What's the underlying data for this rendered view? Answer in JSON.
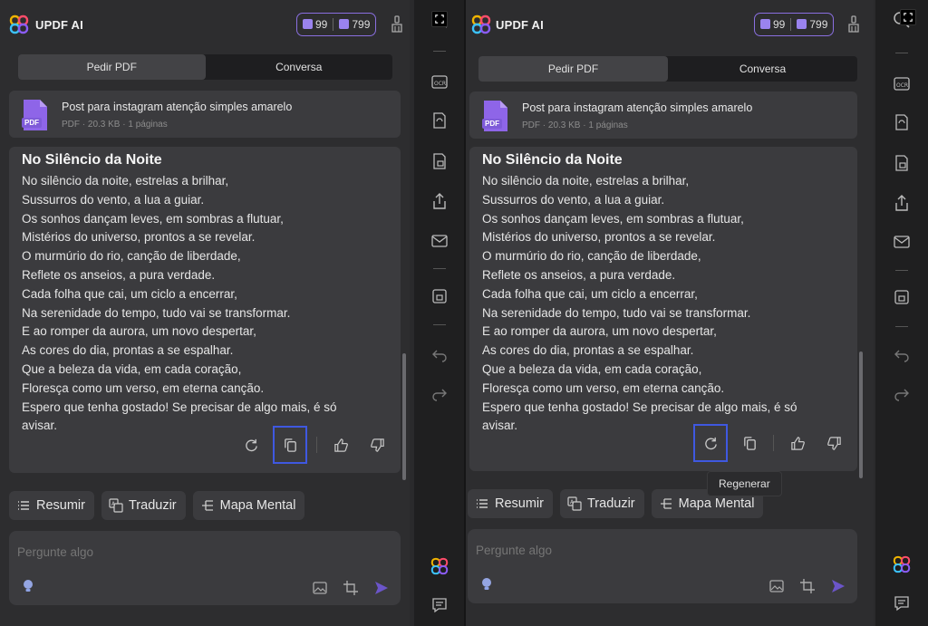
{
  "app": {
    "brand": "UPDF AI",
    "credit_pdf": "99",
    "credit_chat": "799"
  },
  "tabs": [
    "Pedir PDF",
    "Conversa"
  ],
  "file": {
    "name": "Post para instagram atenção simples amarelo",
    "meta": "PDF · 20.3 KB · 1 páginas",
    "badge": "PDF"
  },
  "answer": {
    "title": "No Silêncio da Noite",
    "lines": [
      "No silêncio da noite, estrelas a brilhar,",
      "Sussurros do vento, a lua a guiar.",
      "Os sonhos dançam leves, em sombras a flutuar,",
      "Mistérios do universo, prontos a se revelar.",
      "O murmúrio do rio, canção de liberdade,",
      "Reflete os anseios, a pura verdade.",
      "Cada folha que cai, um ciclo a encerrar,",
      "Na serenidade do tempo, tudo vai se transformar.",
      "E ao romper da aurora, um novo despertar,",
      "As cores do dia, prontas a se espalhar.",
      "Que a beleza da vida, em cada coração,",
      "Floresça como um verso, em eterna canção.",
      "Espero que tenha gostado! Se precisar de algo mais, é só",
      "avisar."
    ]
  },
  "quick_actions": [
    "Resumir",
    "Traduzir",
    "Mapa Mental"
  ],
  "input": {
    "placeholder": "Pergunte algo"
  },
  "tooltip": "Regenerar",
  "colors": {
    "accent": "#8a6fe0",
    "highlight": "#3f58e0",
    "send": "#6b55c9"
  }
}
